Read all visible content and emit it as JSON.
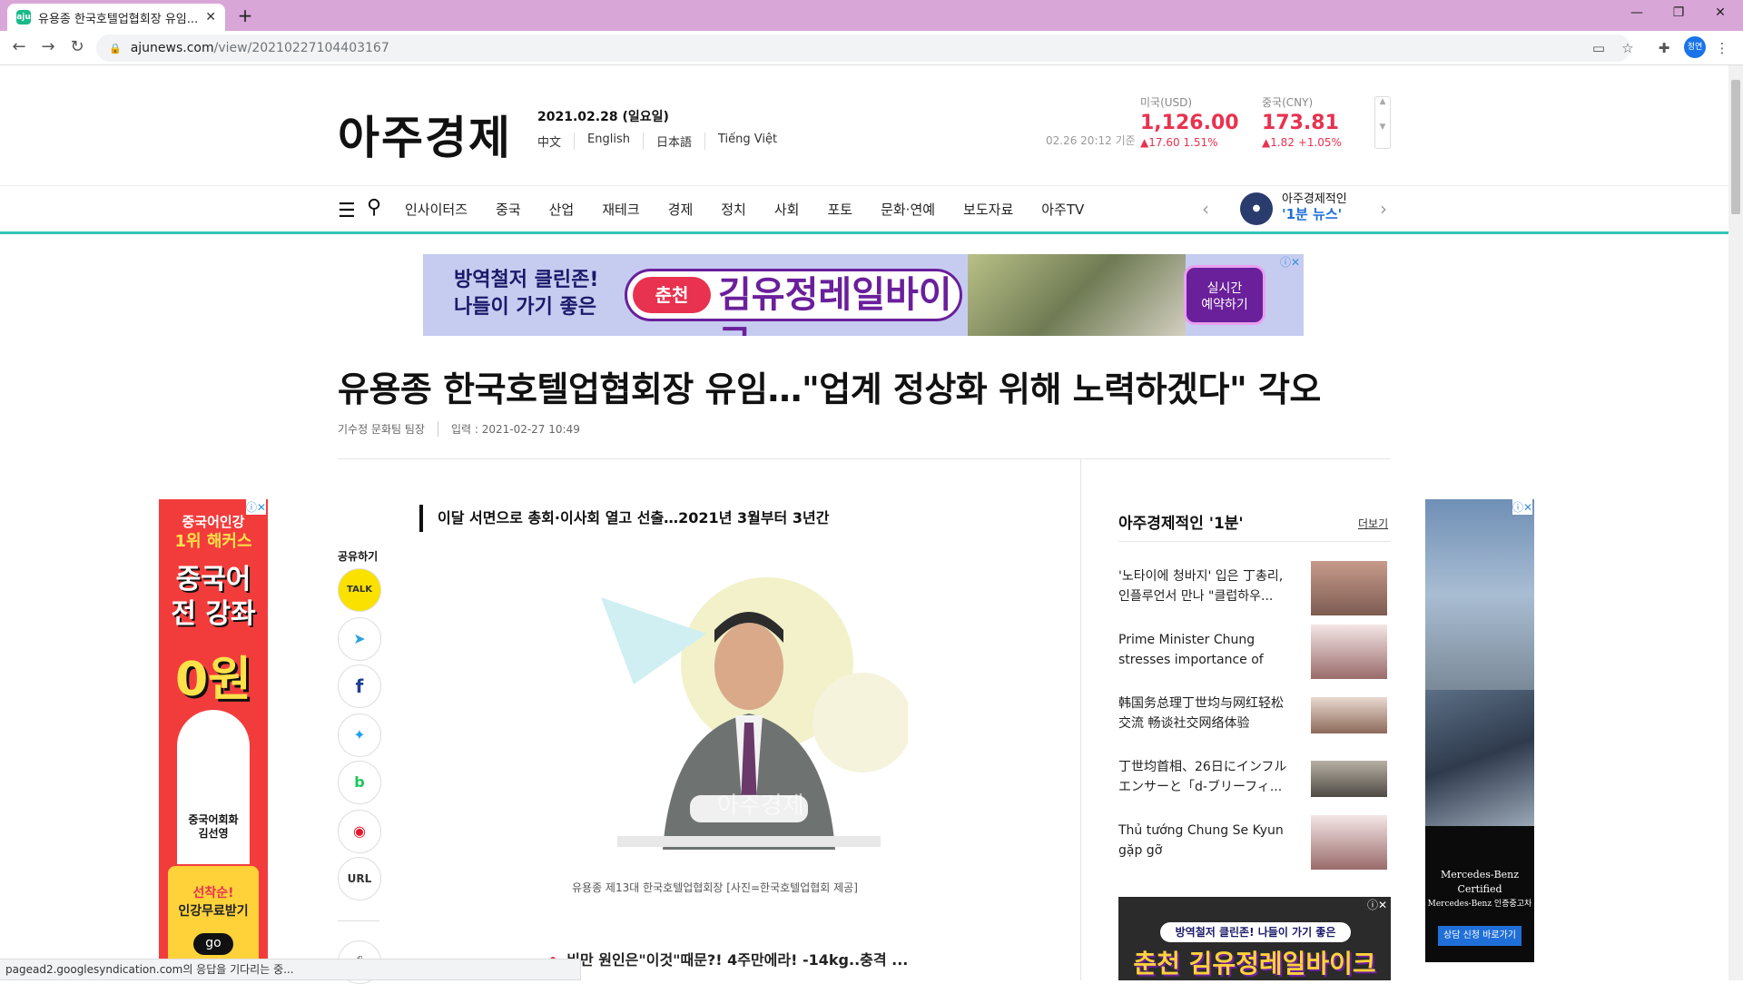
{
  "browser": {
    "tab_title": "유용종 한국호텔업협회장 유임...",
    "tab_favicon": "aju",
    "new_tab": "+",
    "url_host": "ajunews.com",
    "url_path": "/view/20210227104403167",
    "profile_label": "정연",
    "status_text": "pagead2.googlesyndication.com의 응답을 기다리는 중..."
  },
  "site": {
    "logo": "아주경제",
    "date": "2021.02.28 (일요일)",
    "languages": [
      "中文",
      "English",
      "日本語",
      "Tiếng Việt"
    ],
    "fx_date": "02.26 20:12 기준",
    "fx": [
      {
        "label": "미국(USD)",
        "value": "1,126.00",
        "change": "▲17.60 1.51%"
      },
      {
        "label": "중국(CNY)",
        "value": "173.81",
        "change": "▲1.82 +1.05%"
      }
    ],
    "nav": [
      "인사이터즈",
      "중국",
      "산업",
      "재테크",
      "경제",
      "정치",
      "사회",
      "포토",
      "문화·연예",
      "보도자료",
      "아주TV"
    ],
    "promo_line1": "아주경제적인",
    "promo_line2": "'1분 뉴스'"
  },
  "top_ad": {
    "line1": "방역철저 클린존!",
    "line2": "나들이 가기 좋은",
    "city": "춘천",
    "name": "김유정레일바이크",
    "cta1": "실시간",
    "cta2": "예약하기"
  },
  "article": {
    "headline": "유용종 한국호텔업협회장 유임…\"업계 정상화 위해 노력하겠다\" 각오",
    "author": "기수정 문화팀 팀장",
    "published": "입력 : 2021-02-27 10:49",
    "subhead": "이달 서면으로 총회·이사회 열고 선출…2021년 3월부터 3년간",
    "share_label": "공유하기",
    "share_buttons": [
      "TALK",
      "telegram-icon",
      "f",
      "twitter-icon",
      "band-icon",
      "weibo-icon",
      "URL"
    ],
    "caption": "유용종 제13대 한국호텔업협회장 [사진=한국호텔업협회 제공]",
    "related": "비만 원인은\"이것\"때문?! 4주만에라! -14kg..충격 ...",
    "watermark": "아주경제"
  },
  "sidebar": {
    "title": "아주경제적인 '1분'",
    "more": "더보기",
    "items": [
      "'노타이에 청바지' 입은 丁총리, 인플루언서 만나 \"클럽하우...",
      "Prime Minister Chung stresses importance of 'borderless...",
      "韩国务总理丁世均与网红轻松交流 畅谈社交网络体验",
      "丁世均首相、26日にインフルエンサーと「d-ブリーフィ...",
      "Thủ tướng Chung Se Kyun gặp gỡ influencer...\"Clubhouse là..."
    ]
  },
  "left_ad": {
    "line1": "중국어인강",
    "line2": "1위 해커스",
    "line3": "중국어",
    "line4": "전 강좌",
    "line5": "0원",
    "teacher1": "중국어회화",
    "teacher2": "김선영",
    "box1": "선착순!",
    "box2": "인강무료받기",
    "go": "go"
  },
  "right_ad": {
    "brand1": "Mercedes-Benz Certified",
    "brand2": "Mercedes-Benz 인증중고차",
    "button": "상담 신청 바로가기"
  },
  "bottom_ad": {
    "line1": "방역철저 클린존! 나들이 가기 좋은",
    "line2": "춘천 김유정레일바이크"
  }
}
